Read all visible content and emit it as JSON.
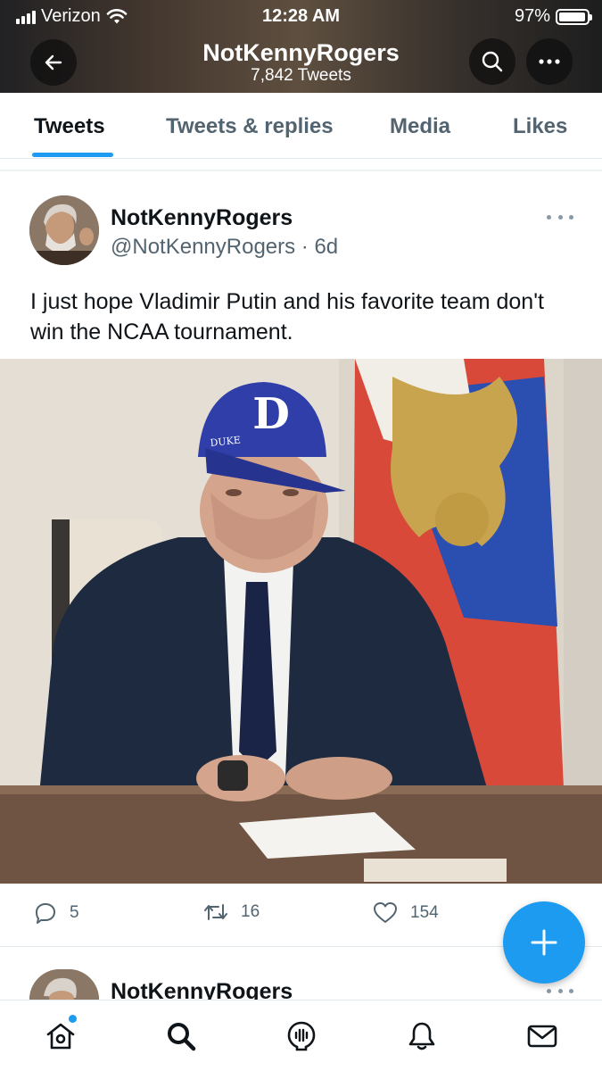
{
  "status_bar": {
    "carrier": "Verizon",
    "time": "12:28 AM",
    "battery": "97%",
    "battery_level": 0.97
  },
  "header": {
    "profile_name": "NotKennyRogers",
    "tweet_count": "7,842 Tweets",
    "back_icon": "arrow-left-icon",
    "search_icon": "search-icon",
    "more_icon": "more-icon"
  },
  "tabs": [
    "Tweets",
    "Tweets & replies",
    "Media",
    "Likes"
  ],
  "tweet": {
    "display_name": "NotKennyRogers",
    "handle_time": "@NotKennyRogers · 6d",
    "text": "I just hope Vladimir Putin and his favorite team don't win the NCAA tournament.",
    "cap_letter": "D",
    "cap_text": "DUKE",
    "replies": "5",
    "retweets": "16",
    "likes": "154"
  },
  "next_tweet": {
    "display_name": "NotKennyRogers"
  },
  "colors": {
    "accent": "#1d9bf0",
    "text": "#0f1419",
    "secondary": "#536471",
    "cap_blue": "#2f3ea8"
  },
  "bottom_nav": [
    "home-icon",
    "search-icon",
    "spaces-icon",
    "bell-icon",
    "mail-icon"
  ]
}
